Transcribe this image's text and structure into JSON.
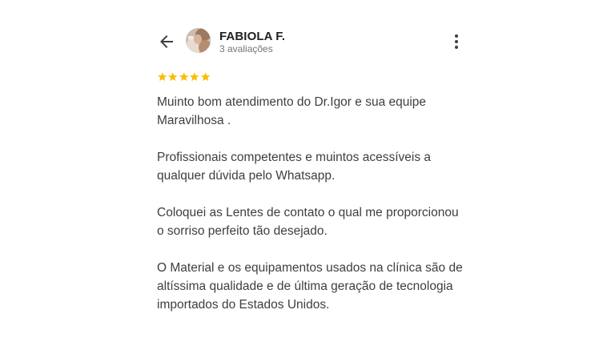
{
  "reviewer": {
    "name": "FABIOLA F.",
    "reviews_count": "3 avaliações"
  },
  "rating": {
    "stars": 5,
    "max": 5,
    "color": "#fbbc04"
  },
  "review": {
    "paragraphs": [
      "Muinto bom atendimento do Dr.Igor e sua equipe\nMaravilhosa .",
      "Profissionais competentes e muintos acessíveis a\nqualquer dúvida pelo Whatsapp.",
      "Coloquei as Lentes de contato o qual me proporcionou\no sorriso perfeito tão desejado.",
      "O Material e os equipamentos usados na clínica são de\naltíssima qualidade e de última geração de tecnologia\nimportados do Estados Unidos."
    ]
  },
  "icons": {
    "back": "arrow-back-icon",
    "more": "more-vert-icon"
  }
}
